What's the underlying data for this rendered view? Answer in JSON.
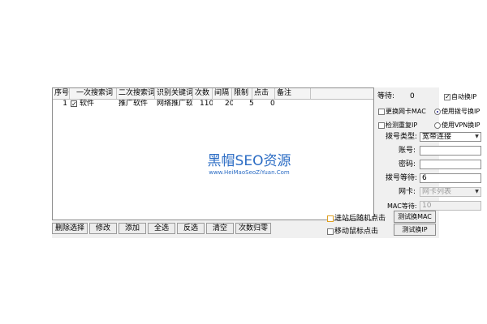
{
  "table": {
    "columns": [
      "序号",
      "一次搜索词",
      "二次搜索词",
      "识别关键词",
      "次数",
      "间隔",
      "限制",
      "点击",
      "备注"
    ],
    "rows": [
      {
        "index": "1",
        "checked": true,
        "first": "软件",
        "second": "推广软件",
        "keyword": "网络推广软",
        "count": "110",
        "interval": "20",
        "limit": "5",
        "clicks": "0",
        "note": ""
      }
    ]
  },
  "watermark": {
    "main": "黑帽SEO资源",
    "sub": "www.HeiMaoSeoZiYuan.Com"
  },
  "buttons": {
    "delete": "删除选择",
    "edit": "修改",
    "add": "添加",
    "select_all": "全选",
    "invert": "反选",
    "clear": "清空",
    "reset_count": "次数归零"
  },
  "panel": {
    "wait_label": "等待:",
    "wait_value": "0",
    "auto_ip": "自动换IP",
    "auto_ip_checked": true,
    "change_mac": "更换网卡MAC",
    "change_mac_checked": false,
    "use_dial": "使用拨号换IP",
    "use_dial_selected": true,
    "check_repeat": "检测重复IP",
    "check_repeat_checked": false,
    "use_vpn": "使用VPN换IP",
    "use_vpn_selected": false,
    "dial_type_label": "拨号类型:",
    "dial_type_value": "宽带连接",
    "account_label": "账号:",
    "account_value": "",
    "password_label": "密码:",
    "password_value": "",
    "dial_wait_label": "拨号等待:",
    "dial_wait_value": "6",
    "nic_label": "网卡:",
    "nic_value": "网卡列表",
    "mac_wait_label": "MAC等待:",
    "mac_wait_value": "10",
    "random_click": "进站后随机点击",
    "random_click_checked": false,
    "mouse_click": "移动鼠标点击",
    "mouse_click_checked": false,
    "test_mac": "测试换MAC",
    "test_ip": "测试换IP"
  },
  "colors": {
    "watermark": "#2b6cc4",
    "random_click_border": "#e0a020"
  }
}
